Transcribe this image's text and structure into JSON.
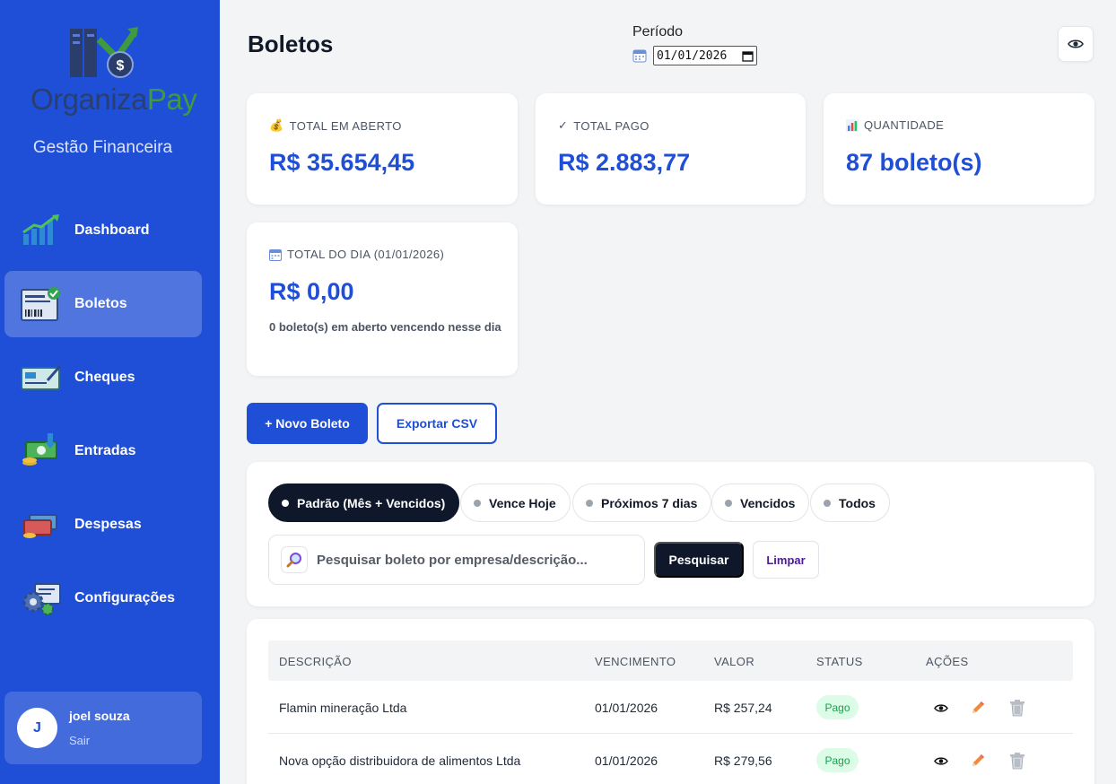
{
  "sidebar": {
    "logo": {
      "part1": "Organiza",
      "part2": "Pay"
    },
    "tagline": "Gestão Financeira",
    "items": [
      {
        "label": "Dashboard",
        "icon": "chart-growth-icon"
      },
      {
        "label": "Boletos",
        "icon": "boleto-document-icon",
        "active": true
      },
      {
        "label": "Cheques",
        "icon": "cheque-icon"
      },
      {
        "label": "Entradas",
        "icon": "money-in-icon"
      },
      {
        "label": "Despesas",
        "icon": "expenses-icon"
      },
      {
        "label": "Configurações",
        "icon": "gears-icon"
      }
    ],
    "user": {
      "initial": "J",
      "name": "joel souza",
      "logout": "Sair"
    }
  },
  "header": {
    "title": "Boletos",
    "period_label": "Período",
    "period_value": "01/01/2026"
  },
  "stats": {
    "open": {
      "label": "TOTAL EM ABERTO",
      "value": "R$ 35.654,45",
      "icon": "money-bag-icon"
    },
    "paid": {
      "label": "TOTAL PAGO",
      "value": "R$ 2.883,77",
      "icon": "check-icon"
    },
    "count": {
      "label": "QUANTIDADE",
      "value": "87 boleto(s)",
      "icon": "bar-chart-icon"
    },
    "day": {
      "label": "TOTAL DO DIA (01/01/2026)",
      "value": "R$ 0,00",
      "note": "0 boleto(s) em aberto vencendo nesse dia",
      "icon": "calendar-icon"
    }
  },
  "actions": {
    "new": "+ Novo Boleto",
    "export": "Exportar CSV"
  },
  "filters": {
    "chips": [
      "Padrão (Mês + Vencidos)",
      "Vence Hoje",
      "Próximos 7 dias",
      "Vencidos",
      "Todos"
    ],
    "active_index": 0,
    "search_placeholder": "Pesquisar boleto por empresa/descrição...",
    "search_button": "Pesquisar",
    "clear_button": "Limpar"
  },
  "table": {
    "headers": [
      "DESCRIÇÃO",
      "VENCIMENTO",
      "VALOR",
      "STATUS",
      "AÇÕES"
    ],
    "rows": [
      {
        "descricao": "Flamin mineração Ltda",
        "vencimento": "01/01/2026",
        "valor": "R$ 257,24",
        "status": "Pago"
      },
      {
        "descricao": "Nova opção distribuidora de alimentos Ltda",
        "vencimento": "01/01/2026",
        "valor": "R$ 279,56",
        "status": "Pago"
      }
    ]
  },
  "colors": {
    "primary": "#1f4fd6",
    "dark": "#0f172a",
    "success": "#16a34a",
    "success_bg": "#dcfce7"
  }
}
